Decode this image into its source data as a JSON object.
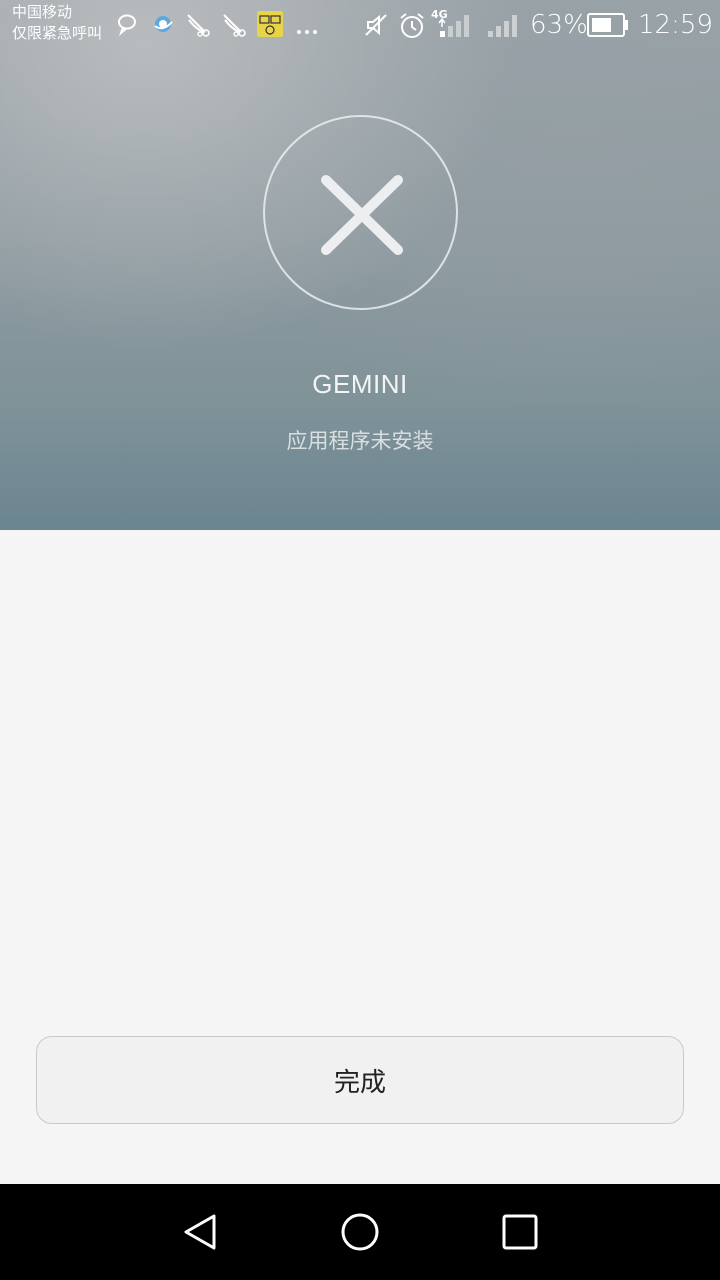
{
  "status_bar": {
    "carrier_line1": "中国移动",
    "carrier_line2": "仅限紧急呼叫",
    "network_type": "4G",
    "battery_percent": "63%",
    "time": "12:59",
    "left_icons": [
      "chat-bubble-icon",
      "browser-icon",
      "satellite-icon",
      "satellite-icon",
      "calendar-app-icon",
      "more-dots-icon"
    ],
    "right_icons": [
      "mute-icon",
      "alarm-icon",
      "signal-icon",
      "signal-icon",
      "battery-icon"
    ]
  },
  "install_result": {
    "app_name": "GEMINI",
    "message": "应用程序未安装"
  },
  "actions": {
    "done_label": "完成"
  },
  "nav_bar": {
    "buttons": [
      "back-icon",
      "home-icon",
      "recents-icon"
    ]
  }
}
